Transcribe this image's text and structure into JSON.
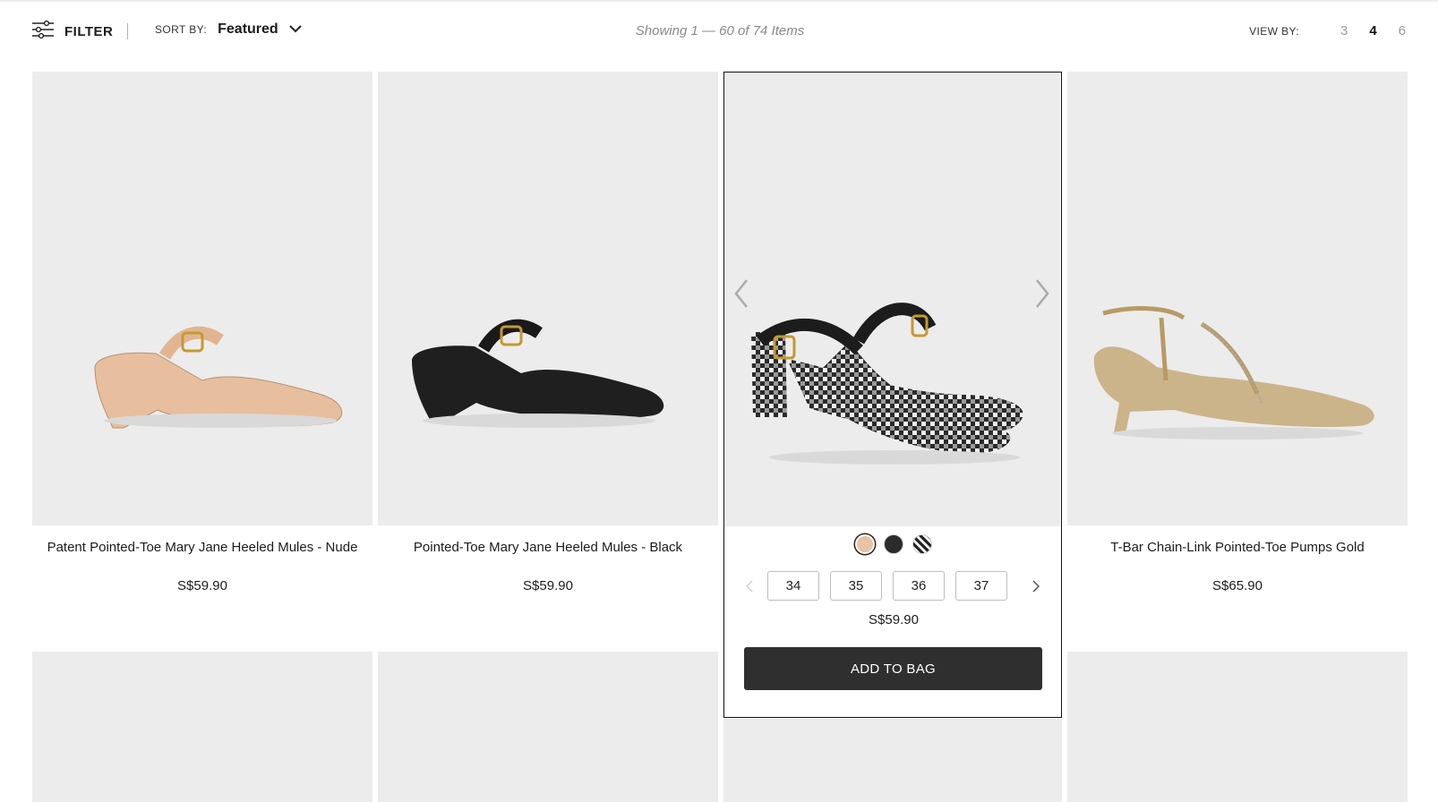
{
  "toolbar": {
    "filter_label": "FILTER",
    "sort_label": "SORT BY:",
    "sort_value": "Featured",
    "showing_text": "Showing 1 — 60 of 74 Items",
    "viewby_label": "VIEW BY:",
    "view_options": [
      "3",
      "4",
      "6"
    ],
    "view_selected": "4"
  },
  "products": [
    {
      "name": "Patent Pointed-Toe Mary Jane Heeled Mules - Nude",
      "price": "S$59.90",
      "image_color": "#e9c3a4"
    },
    {
      "name": "Pointed-Toe Mary Jane Heeled Mules - Black",
      "price": "S$59.90",
      "image_color": "#1f1f1f"
    },
    {
      "hovered": true,
      "price": "S$59.90",
      "swatches": [
        "nude",
        "black",
        "tweed"
      ],
      "selected_swatch": "nude",
      "sizes": [
        "34",
        "35",
        "36",
        "37"
      ],
      "add_to_bag_label": "ADD TO BAG"
    },
    {
      "name": "T-Bar Chain-Link Pointed-Toe Pumps  Gold",
      "price": "S$65.90",
      "image_color": "#cdb58a"
    }
  ],
  "colors": {
    "tile_bg": "#ececec",
    "button_bg": "#2f2f2f",
    "accent_text": "#1c1c1c"
  },
  "icons": [
    "sliders-icon",
    "chevron-down-icon",
    "chevron-left-icon",
    "chevron-right-icon"
  ]
}
